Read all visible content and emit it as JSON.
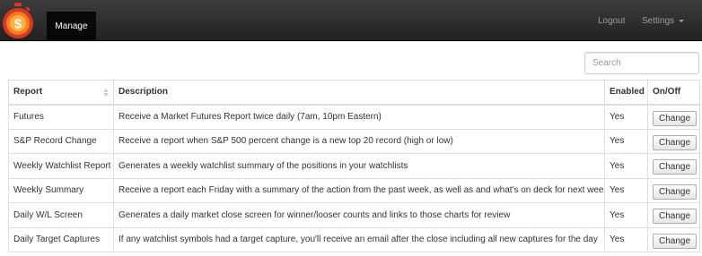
{
  "nav": {
    "active_tab": "Manage",
    "logout": "Logout",
    "settings": "Settings"
  },
  "search": {
    "placeholder": "Search"
  },
  "table": {
    "headers": {
      "report": "Report",
      "description": "Description",
      "enabled": "Enabled",
      "onoff": "On/Off"
    },
    "rows": [
      {
        "report": "Futures",
        "description": "Receive a Market Futures Report twice daily (7am, 10pm Eastern)",
        "enabled": "Yes",
        "button": "Change"
      },
      {
        "report": "S&P Record Change",
        "description": "Receive a report when S&P 500 percent change is a new top 20 record (high or low)",
        "enabled": "Yes",
        "button": "Change"
      },
      {
        "report": "Weekly Watchlist Report",
        "description": "Generates a weekly watchlist summary of the positions in your watchlists",
        "enabled": "Yes",
        "button": "Change"
      },
      {
        "report": "Weekly Summary",
        "description": "Receive a report each Friday with a summary of the action from the past week, as well as and what's on deck for next week.",
        "enabled": "Yes",
        "button": "Change"
      },
      {
        "report": "Daily W/L Screen",
        "description": "Generates a daily market close screen for winner/looser counts and links to those charts for review",
        "enabled": "Yes",
        "button": "Change"
      },
      {
        "report": "Daily Target Captures",
        "description": "If any watchlist symbols had a target capture, you'll receive an email after the close including all new captures for the day",
        "enabled": "Yes",
        "button": "Change"
      }
    ]
  },
  "colors": {
    "navbar": "#222222",
    "logo_orange": "#f57c1f",
    "logo_red": "#d9381e"
  },
  "logo_icon": "dollar-stopwatch-icon"
}
